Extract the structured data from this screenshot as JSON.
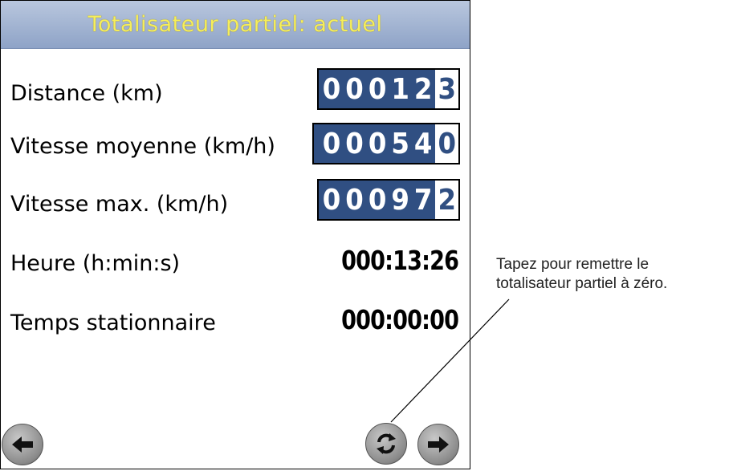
{
  "header": {
    "title": "Totalisateur partiel: actuel"
  },
  "rows": [
    {
      "label": "Distance (km)",
      "digits": "00012",
      "active_digit": "3"
    },
    {
      "label": "Vitesse moyenne (km/h)",
      "digits": "00054",
      "active_digit": "0"
    },
    {
      "label": "Vitesse max. (km/h)",
      "digits": "00097",
      "active_digit": "2"
    },
    {
      "label": "Heure (h:min:s)",
      "value": "000:13:26"
    },
    {
      "label": "Temps stationnaire",
      "value": "000:00:00"
    }
  ],
  "buttons": {
    "back": "arrow-left-icon",
    "reset": "refresh-icon",
    "forward": "arrow-right-icon"
  },
  "callout": {
    "line1": "Tapez pour remettre le",
    "line2": "totalisateur partiel à zéro."
  },
  "colors": {
    "title_text": "#f6ee5a",
    "title_bar": "#8ea3c7",
    "counter_bg": "#304f82"
  }
}
